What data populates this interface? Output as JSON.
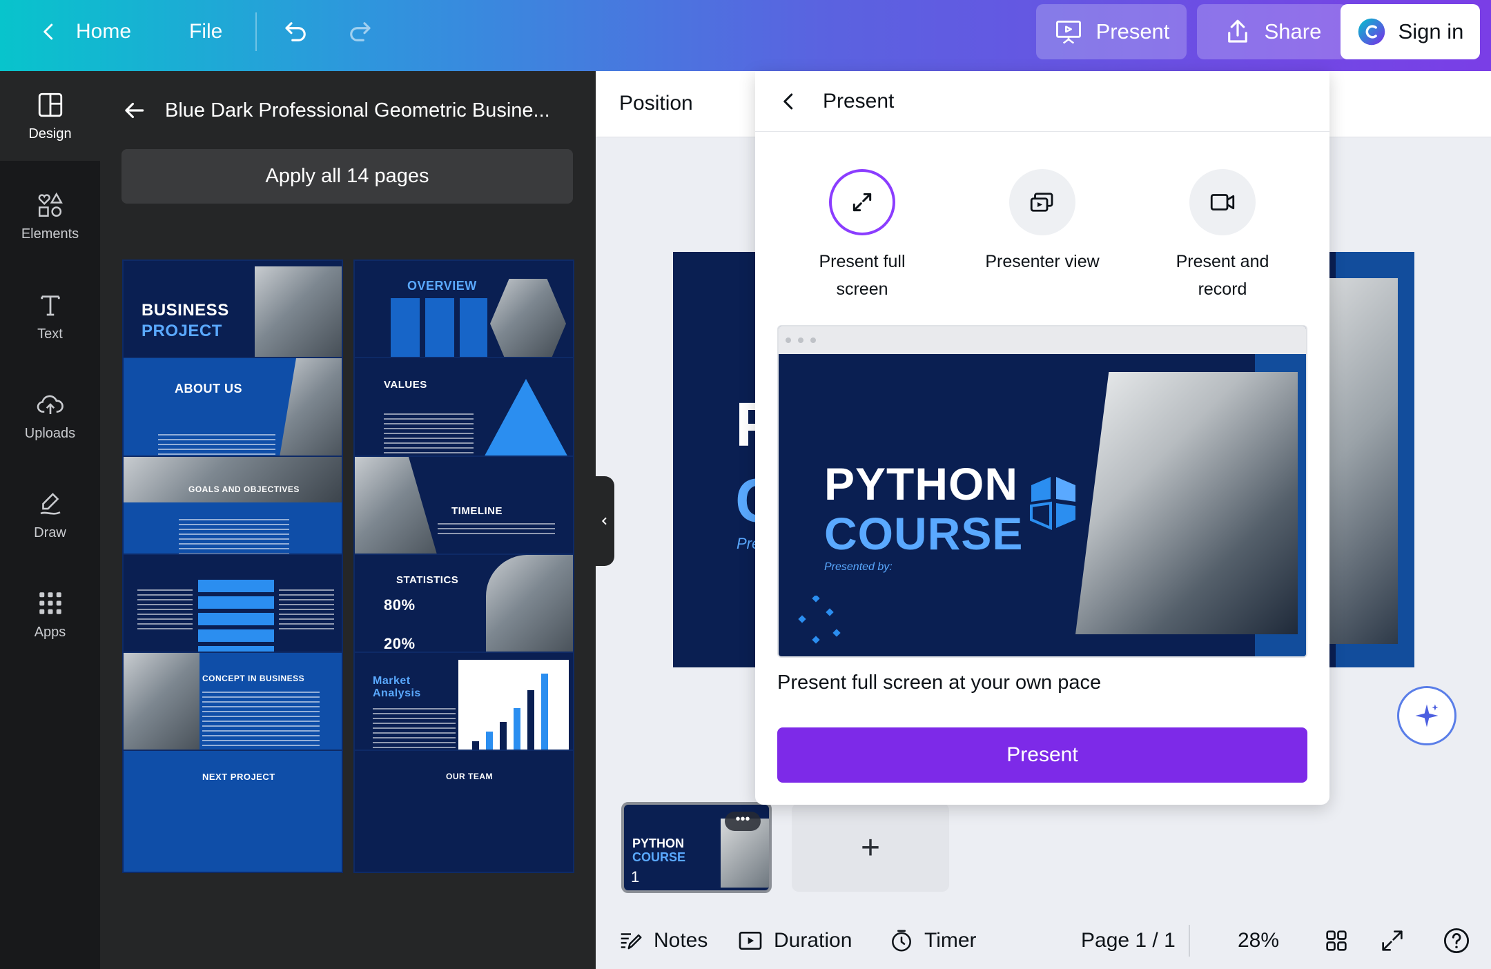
{
  "topbar": {
    "home_label": "Home",
    "file_label": "File",
    "present_label": "Present",
    "share_label": "Share",
    "signin_label": "Sign in"
  },
  "rail": {
    "items": [
      {
        "label": "Design"
      },
      {
        "label": "Elements"
      },
      {
        "label": "Text"
      },
      {
        "label": "Uploads"
      },
      {
        "label": "Draw"
      },
      {
        "label": "Apps"
      }
    ]
  },
  "design_panel": {
    "title": "Blue Dark Professional Geometric Busine...",
    "apply_label": "Apply all 14 pages",
    "thumbs": [
      {
        "title": "BUSINESS",
        "title2": "PROJECT"
      },
      {
        "title": "OVERVIEW"
      },
      {
        "title": "ABOUT US"
      },
      {
        "title": "VALUES"
      },
      {
        "title": "GOALS AND OBJECTIVES"
      },
      {
        "title": "TIMELINE"
      },
      {
        "title": ""
      },
      {
        "title": "STATISTICS",
        "stat1": "80%",
        "stat2": "20%"
      },
      {
        "title": "CONCEPT IN BUSINESS"
      },
      {
        "title": "Market Analysis"
      },
      {
        "title": "NEXT PROJECT"
      },
      {
        "title": "OUR TEAM"
      }
    ]
  },
  "canvas": {
    "context_label": "Position"
  },
  "popover": {
    "title": "Present",
    "options": [
      {
        "label": "Present full screen"
      },
      {
        "label": "Presenter view"
      },
      {
        "label": "Present and record"
      }
    ],
    "preview": {
      "title1": "PYTHON",
      "title2": "COURSE",
      "subtitle": "Presented by:"
    },
    "description": "Present full screen at your own pace",
    "present_button": "Present"
  },
  "pages": {
    "thumb_title1": "PYTHON",
    "thumb_title2": "COURSE",
    "thumb_number": "1",
    "thumb_menu": "•••",
    "add_label": "+"
  },
  "bottombar": {
    "notes_label": "Notes",
    "duration_label": "Duration",
    "timer_label": "Timer",
    "page_indicator": "Page 1 / 1",
    "zoom": "28%"
  },
  "colors": {
    "accent": "#7d2ae8",
    "slide_bg": "#0a1f52",
    "slide_accent": "#5aa9ff"
  }
}
